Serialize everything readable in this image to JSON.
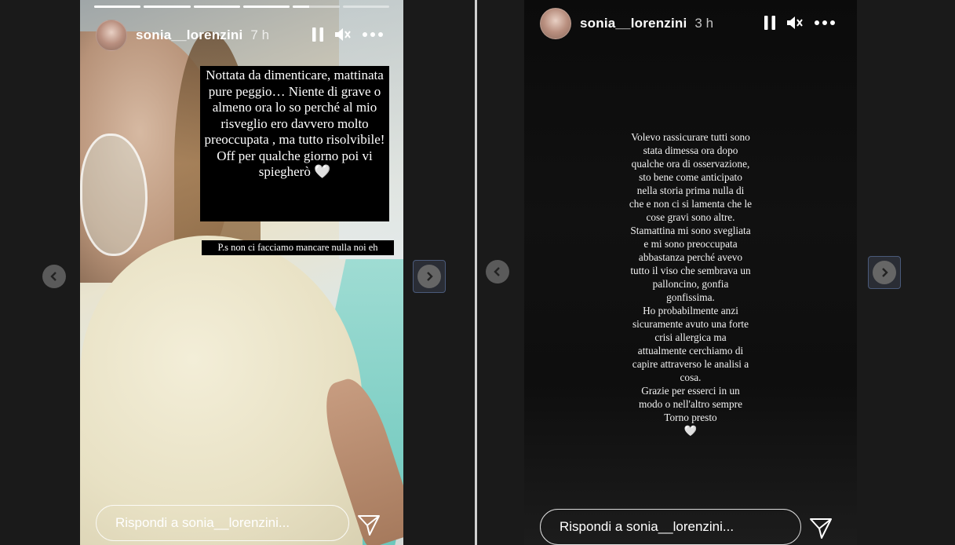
{
  "stories": [
    {
      "username": "sonia__lorenzini",
      "time": "7 h",
      "progress": [
        1,
        1,
        1,
        1,
        0.35,
        0
      ],
      "caption_main": "Nottata da dimenticare, mattinata pure peggio… Niente di grave o almeno ora lo so perché al mio risveglio ero davvero molto preoccupata , ma tutto risolvibile! Off per qualche giorno poi vi spiegherò 🤍",
      "caption_ps": "P.s non ci facciamo mancare nulla noi eh",
      "reply_placeholder": "Rispondi a sonia__lorenzini..."
    },
    {
      "username": "sonia__lorenzini",
      "time": "3 h",
      "text": "Volevo rassicurare tutti sono\nstata dimessa ora dopo\nqualche ora di osservazione,\nsto bene come anticipato\nnella storia prima nulla di\nche e non ci si lamenta che le\ncose gravi sono altre.\nStamattina mi sono svegliata\ne mi sono preoccupata\nabbastanza perché avevo\ntutto il viso che sembrava un\npalloncino, gonfia\ngonfissima.\nHo probabilmente anzi\nsicuramente avuto una forte\ncrisi allergica ma\nattualmente cerchiamo di\ncapire attraverso le analisi a\ncosa.\nGrazie per esserci in un\nmodo o nell'altro sempre\nTorno presto\n🤍",
      "reply_placeholder": "Rispondi a sonia__lorenzini..."
    }
  ],
  "icons": {
    "pause": "pause-icon",
    "mute": "mute-icon",
    "more": "more-options-icon",
    "send": "send-icon",
    "prev": "chevron-left-icon",
    "next": "chevron-right-icon"
  }
}
